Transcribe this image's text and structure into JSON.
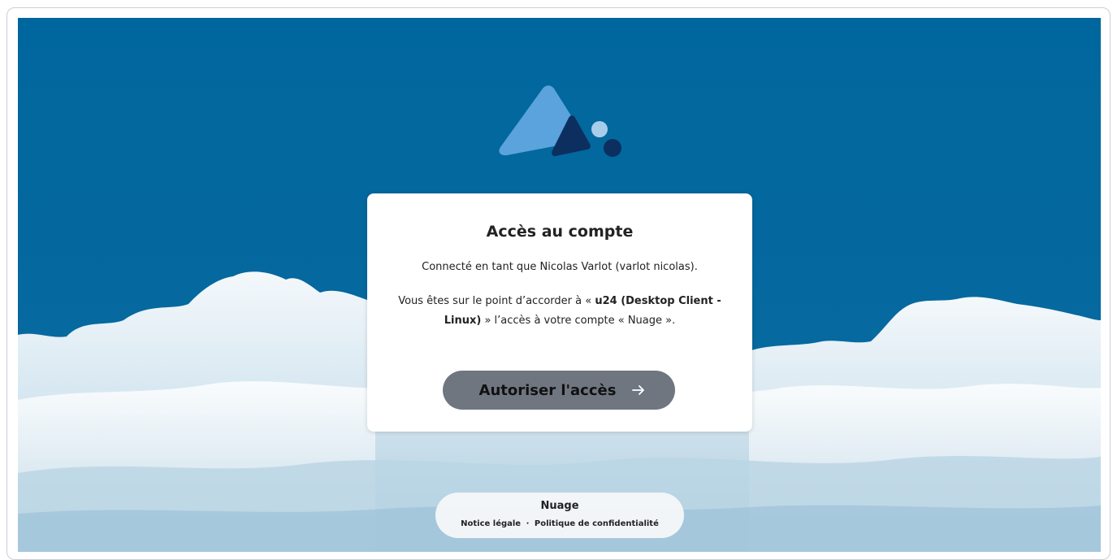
{
  "colors": {
    "background": "#00679e",
    "card": "#ffffff",
    "button": "#6f7680",
    "logo_light": "#5ba3dc",
    "logo_dark": "#0c2f5f"
  },
  "logo": {
    "icon": "nuage-logo-icon"
  },
  "card": {
    "title": "Accès au compte",
    "connected_as": "Connecté en tant que Nicolas Varlot (varlot nicolas).",
    "grant_prefix": "Vous êtes sur le point d’accorder à « ",
    "client_name": "u24 (Desktop Client - Linux)",
    "grant_middle": " » l’accès à votre compte « ",
    "account_name": "Nuage",
    "grant_suffix": " ».",
    "button_label": "Autoriser l'accès",
    "button_icon": "arrow-right-icon"
  },
  "footer": {
    "name": "Nuage",
    "legal_link": "Notice légale",
    "separator": "·",
    "privacy_link": "Politique de confidentialité"
  }
}
